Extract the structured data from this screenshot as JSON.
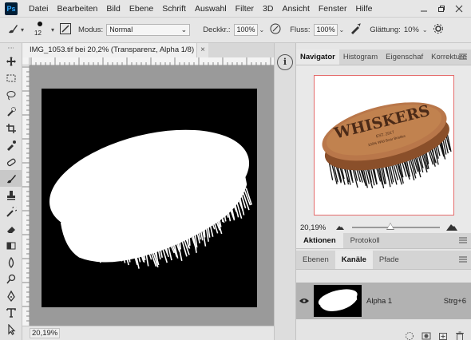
{
  "app": {
    "logo_text": "Ps"
  },
  "menu": {
    "items": [
      "Datei",
      "Bearbeiten",
      "Bild",
      "Ebene",
      "Schrift",
      "Auswahl",
      "Filter",
      "3D",
      "Ansicht",
      "Fenster",
      "Hilfe"
    ]
  },
  "options_bar": {
    "brush_size": "12",
    "mode_label": "Modus:",
    "mode_value": "Normal",
    "opacity_label": "Deckkr.:",
    "opacity_value": "100%",
    "flow_label": "Fluss:",
    "flow_value": "100%",
    "smoothing_label": "Glättung:",
    "smoothing_value": "10%"
  },
  "document": {
    "tab_title": "IMG_1053.tif bei 20,2% (Transparenz, Alpha 1/8) *",
    "close_symbol": "×",
    "zoom": "20,19%"
  },
  "navigator": {
    "tabs": [
      "Navigator",
      "Histogram",
      "Eigenschaf",
      "Korrekture"
    ],
    "zoom": "20,19%",
    "slider_position": 0.4
  },
  "actions_panel": {
    "tabs": [
      "Aktionen",
      "Protokoll"
    ]
  },
  "channels_panel": {
    "tabs": [
      "Ebenen",
      "Kanäle",
      "Pfade"
    ],
    "channels": [
      {
        "name": "Alpha 1",
        "shortcut": "Strg+6"
      }
    ]
  },
  "product": {
    "brand": "WHISKERS",
    "sub1": "EST. 2017",
    "sub2": "100% Wild Boar Bristles"
  },
  "colors": {
    "canvas_bg": "#000000",
    "mask_fg": "#ffffff",
    "wood": "#b9774a",
    "nav_border": "#e56b6b",
    "active_row": "#b2b2b2"
  }
}
